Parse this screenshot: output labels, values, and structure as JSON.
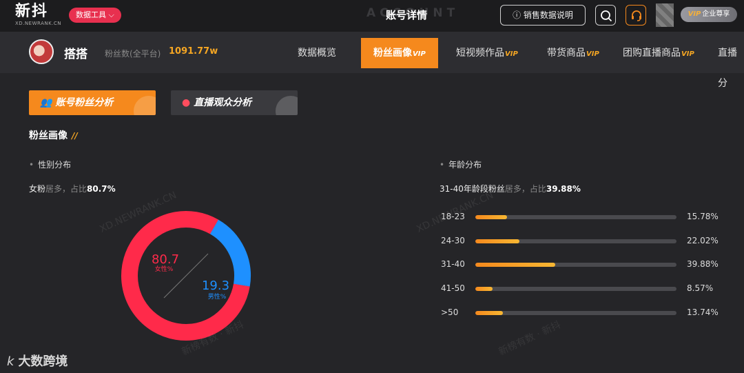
{
  "topbar": {
    "logo": "新抖",
    "logo_sub": "XD.NEWRANK.CN",
    "tools_label": "数据工具",
    "page_title": "账号详情",
    "page_title_bg": "ACCOUNT",
    "explain_label": "销售数据说明",
    "vip_badge_tag": "VIP",
    "vip_badge_text": "企业尊享"
  },
  "account": {
    "name": "搭搭",
    "fans_label": "粉丝数(全平台)",
    "fans_value": "1091.77w"
  },
  "tabs": [
    {
      "label": "数据概览",
      "vip": ""
    },
    {
      "label": "粉丝画像",
      "vip": "VIP"
    },
    {
      "label": "短视频作品",
      "vip": "VIP"
    },
    {
      "label": "带货商品",
      "vip": "VIP"
    },
    {
      "label": "团购直播商品",
      "vip": "VIP"
    },
    {
      "label": "直播分",
      "vip": ""
    }
  ],
  "subtabs": {
    "fans": "账号粉丝分析",
    "live": "直播观众分析"
  },
  "section": {
    "title": "粉丝画像",
    "marks": "//"
  },
  "gender": {
    "label": "性别分布",
    "summary_a": "女粉",
    "summary_b": "居多，占比",
    "summary_value": "80.7%",
    "female_value": "80.7",
    "female_label": "女性%",
    "male_value": "19.3",
    "male_label": "男性%",
    "female_color": "#ff2a4a",
    "male_color": "#1e90ff"
  },
  "age": {
    "label": "年龄分布",
    "summary_a": "31-40年龄段粉丝",
    "summary_b": "居多，占比",
    "summary_value": "39.88%",
    "rows": [
      {
        "range": "18-23",
        "pct": "15.78%",
        "value": 15.78
      },
      {
        "range": "24-30",
        "pct": "22.02%",
        "value": 22.02
      },
      {
        "range": "31-40",
        "pct": "39.88%",
        "value": 39.88
      },
      {
        "range": "41-50",
        "pct": "8.57%",
        "value": 8.57
      },
      {
        "range": ">50",
        "pct": "13.74%",
        "value": 13.74
      }
    ]
  },
  "watermarks": {
    "site": "XD.NEWRANK.CN",
    "brand": "新榜有数 · 新抖"
  },
  "corner_brand": {
    "k": "k",
    "text": "大数跨境"
  }
}
